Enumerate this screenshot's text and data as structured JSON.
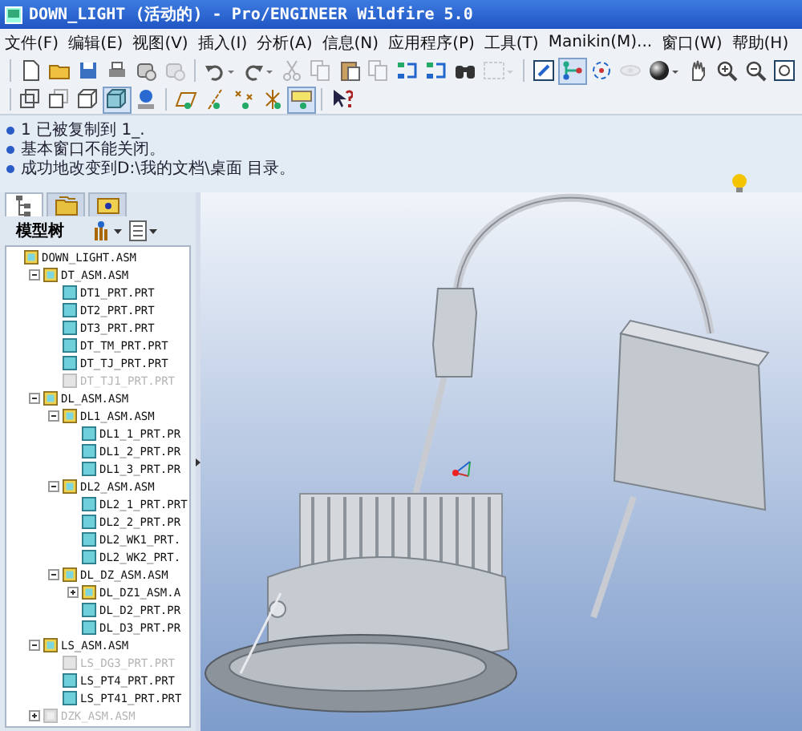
{
  "window": {
    "title": "DOWN_LIGHT (活动的) - Pro/ENGINEER Wildfire 5.0"
  },
  "menu": [
    "文件(F)",
    "编辑(E)",
    "视图(V)",
    "插入(I)",
    "分析(A)",
    "信息(N)",
    "应用程序(P)",
    "工具(T)",
    "Manikin(M)...",
    "窗口(W)",
    "帮助(H)"
  ],
  "toolbar_rows": [
    {
      "groups": [
        {
          "buttons": [
            {
              "kind": "new",
              "pressed": false,
              "disabled": false
            },
            {
              "kind": "open",
              "pressed": false,
              "disabled": false
            },
            {
              "kind": "save",
              "pressed": false,
              "disabled": false
            },
            {
              "kind": "print",
              "pressed": false,
              "disabled": false
            },
            {
              "kind": "send",
              "pressed": false,
              "disabled": false
            },
            {
              "kind": "send",
              "pressed": false,
              "disabled": true
            }
          ]
        },
        {
          "buttons": [
            {
              "kind": "undo",
              "pressed": false,
              "disabled": false
            },
            {
              "kind": "redo",
              "pressed": false,
              "disabled": false
            },
            {
              "kind": "cut",
              "pressed": false,
              "disabled": true
            },
            {
              "kind": "copy",
              "pressed": false,
              "disabled": true
            },
            {
              "kind": "paste",
              "pressed": false,
              "disabled": false
            },
            {
              "kind": "copy",
              "pressed": false,
              "disabled": true
            },
            {
              "kind": "regenerate",
              "pressed": false,
              "disabled": false
            },
            {
              "kind": "regenerate",
              "pressed": false,
              "disabled": false
            },
            {
              "kind": "find",
              "pressed": false,
              "disabled": false
            },
            {
              "kind": "select-box",
              "pressed": false,
              "disabled": true
            }
          ]
        },
        {
          "buttons": [
            {
              "kind": "repaint",
              "pressed": false,
              "disabled": false
            },
            {
              "kind": "datum",
              "pressed": true,
              "disabled": false
            },
            {
              "kind": "spin",
              "pressed": false,
              "disabled": false
            },
            {
              "kind": "orient",
              "pressed": false,
              "disabled": true
            },
            {
              "kind": "shade",
              "pressed": false,
              "disabled": false
            },
            {
              "kind": "pan",
              "pressed": false,
              "disabled": false
            },
            {
              "kind": "zoom-in",
              "pressed": false,
              "disabled": false
            },
            {
              "kind": "zoom-out",
              "pressed": false,
              "disabled": false
            },
            {
              "kind": "refit",
              "pressed": false,
              "disabled": false
            }
          ]
        }
      ]
    },
    {
      "groups": [
        {
          "buttons": [
            {
              "kind": "wireframe",
              "pressed": false,
              "disabled": false
            },
            {
              "kind": "hidden-line",
              "pressed": false,
              "disabled": false
            },
            {
              "kind": "no-hidden",
              "pressed": false,
              "disabled": false
            },
            {
              "kind": "shading",
              "pressed": true,
              "disabled": false
            },
            {
              "kind": "display",
              "pressed": false,
              "disabled": false
            }
          ]
        },
        {
          "buttons": [
            {
              "kind": "datum-plane",
              "pressed": false,
              "disabled": false
            },
            {
              "kind": "datum-axis",
              "pressed": false,
              "disabled": false
            },
            {
              "kind": "datum-point",
              "pressed": false,
              "disabled": false
            },
            {
              "kind": "csys",
              "pressed": false,
              "disabled": false
            },
            {
              "kind": "annotation",
              "pressed": true,
              "disabled": false
            }
          ]
        },
        {
          "buttons": [
            {
              "kind": "whats-this",
              "pressed": false,
              "disabled": false
            }
          ]
        }
      ]
    }
  ],
  "messages": [
    "1 已被复制到 1_.",
    "基本窗口不能关闭。",
    "成功地改变到D:\\我的文档\\桌面 目录。"
  ],
  "navigator_tabs": [
    {
      "kind": "model-tree",
      "selected": true
    },
    {
      "kind": "folder",
      "selected": false
    },
    {
      "kind": "favorites",
      "selected": false
    }
  ],
  "model_tree": {
    "title": "模型树",
    "items": [
      {
        "label": "DOWN_LIGHT.ASM",
        "kind": "assembly",
        "disabled": false,
        "children": [
          {
            "label": "DT_ASM.ASM",
            "kind": "assembly",
            "expanded": true,
            "disabled": false,
            "children": [
              {
                "label": "DT1_PRT.PRT",
                "kind": "part",
                "disabled": false
              },
              {
                "label": "DT2_PRT.PRT",
                "kind": "part",
                "disabled": false
              },
              {
                "label": "DT3_PRT.PRT",
                "kind": "part",
                "disabled": false
              },
              {
                "label": "DT_TM_PRT.PRT",
                "kind": "part",
                "disabled": false
              },
              {
                "label": "DT_TJ_PRT.PRT",
                "kind": "part",
                "disabled": false
              },
              {
                "label": "DT_TJ1_PRT.PRT",
                "kind": "part",
                "disabled": true
              }
            ]
          },
          {
            "label": "DL_ASM.ASM",
            "kind": "assembly",
            "expanded": true,
            "disabled": false,
            "children": [
              {
                "label": "DL1_ASM.ASM",
                "kind": "assembly",
                "expanded": true,
                "disabled": false,
                "children": [
                  {
                    "label": "DL1_1_PRT.PR",
                    "kind": "part",
                    "disabled": false
                  },
                  {
                    "label": "DL1_2_PRT.PR",
                    "kind": "part",
                    "disabled": false
                  },
                  {
                    "label": "DL1_3_PRT.PR",
                    "kind": "part",
                    "disabled": false
                  }
                ]
              },
              {
                "label": "DL2_ASM.ASM",
                "kind": "assembly",
                "expanded": true,
                "disabled": false,
                "children": [
                  {
                    "label": "DL2_1_PRT.PRT",
                    "kind": "part",
                    "disabled": false
                  },
                  {
                    "label": "DL2_2_PRT.PR",
                    "kind": "part",
                    "disabled": false
                  },
                  {
                    "label": "DL2_WK1_PRT.",
                    "kind": "part",
                    "disabled": false
                  },
                  {
                    "label": "DL2_WK2_PRT.",
                    "kind": "part",
                    "disabled": false
                  }
                ]
              },
              {
                "label": "DL_DZ_ASM.ASM",
                "kind": "assembly",
                "expanded": true,
                "disabled": false,
                "children": [
                  {
                    "label": "DL_DZ1_ASM.A",
                    "kind": "assembly",
                    "expanded": false,
                    "disabled": false
                  },
                  {
                    "label": "DL_D2_PRT.PR",
                    "kind": "part",
                    "disabled": false
                  },
                  {
                    "label": "DL_D3_PRT.PR",
                    "kind": "part",
                    "disabled": false
                  }
                ]
              }
            ]
          },
          {
            "label": "LS_ASM.ASM",
            "kind": "assembly",
            "expanded": true,
            "disabled": false,
            "children": [
              {
                "label": "LS_DG3_PRT.PRT",
                "kind": "part",
                "disabled": true
              },
              {
                "label": "LS_PT4_PRT.PRT",
                "kind": "part",
                "disabled": false
              },
              {
                "label": "LS_PT41_PRT.PRT",
                "kind": "part",
                "disabled": false
              }
            ]
          },
          {
            "label": "DZK_ASM.ASM",
            "kind": "assembly",
            "expanded": false,
            "disabled": true
          }
        ]
      }
    ]
  }
}
